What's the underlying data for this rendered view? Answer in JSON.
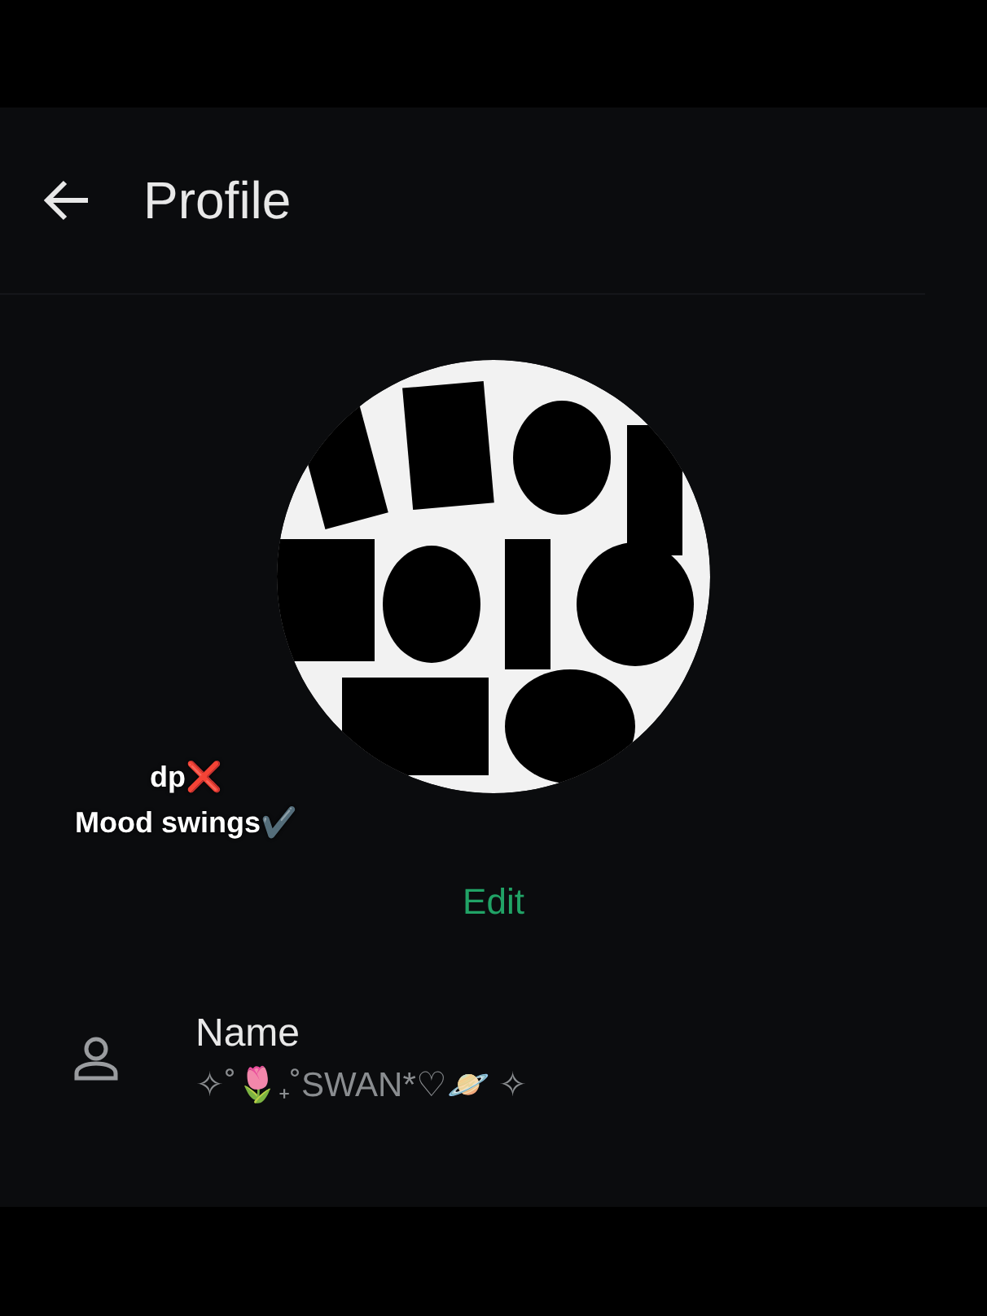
{
  "app_bar": {
    "title": "Profile"
  },
  "caption": [
    "dp❌",
    "Mood swings✔️"
  ],
  "edit_label": "Edit",
  "fields": [
    {
      "label": "Name",
      "value": "✧˚🌷₊˚SWAN*♡🪐 ✧"
    }
  ]
}
